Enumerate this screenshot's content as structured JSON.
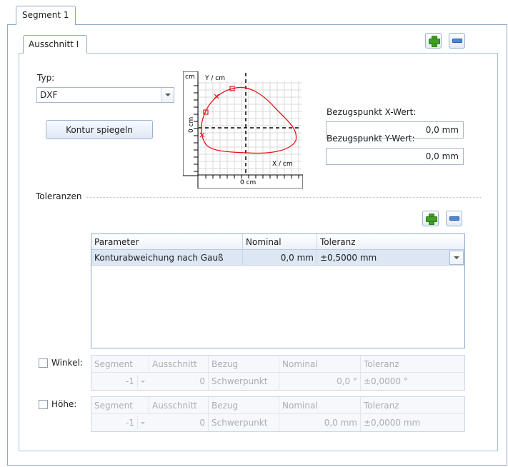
{
  "segment_tab": {
    "label": "Segment 1"
  },
  "section_tab": {
    "label": "Ausschnitt I"
  },
  "typ": {
    "label": "Typ:",
    "value": "DXF"
  },
  "mirror_button": {
    "label": "Kontur spiegeln"
  },
  "preview": {
    "unit_corner": "cm",
    "y_axis_label": "Y / cm",
    "x_axis_label": "X / cm",
    "x_zero_label": "0  cm",
    "y_zero_label": "0  cm",
    "contour_color": "#e8141e"
  },
  "ref_x": {
    "label": "Bezugspunkt X-Wert:",
    "value": "0,0 mm"
  },
  "ref_y": {
    "label": "Bezugspunkt Y-Wert:",
    "value": "0,0 mm"
  },
  "tolerances": {
    "label": "Toleranzen",
    "columns": [
      "Parameter",
      "Nominal",
      "Toleranz"
    ],
    "rows": [
      {
        "parameter": "Konturabweichung nach Gauß",
        "nominal": "0,0 mm",
        "toleranz": "±0,5000 mm"
      }
    ]
  },
  "winkel": {
    "label": "Winkel:",
    "columns": [
      "Segment",
      "Ausschnitt",
      "Bezug",
      "Nominal",
      "Toleranz"
    ],
    "values": [
      "-1",
      "0",
      "Schwerpunkt",
      "0,0 °",
      "±0,0000 °"
    ]
  },
  "hoehe": {
    "label": "Höhe:",
    "columns": [
      "Segment",
      "Ausschnitt",
      "Bezug",
      "Nominal",
      "Toleranz"
    ],
    "values": [
      "-1",
      "0",
      "Schwerpunkt",
      "0,0 mm",
      "±0,0000 mm"
    ]
  },
  "colors": {
    "border": "#8ea8c8",
    "add_icon": "#3fa021",
    "remove_icon": "#4c87d6",
    "selected_row": "#dde7f4"
  }
}
